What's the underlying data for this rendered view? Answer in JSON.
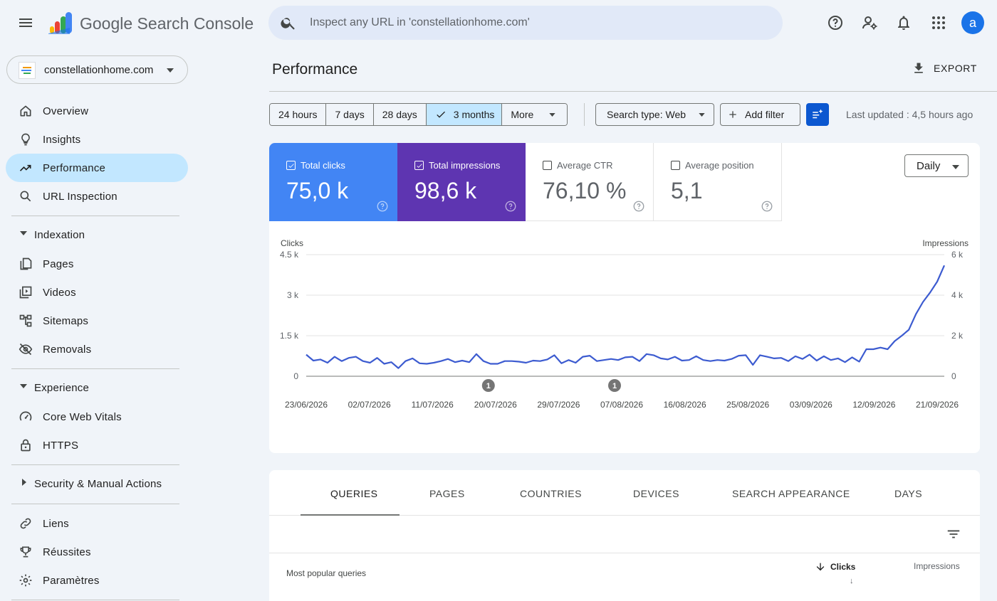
{
  "app": {
    "brand": "Google Search Console",
    "search_placeholder": "Inspect any URL in 'constellationhome.com'",
    "avatar_letter": "a"
  },
  "property": {
    "name": "constellationhome.com"
  },
  "sidebar": {
    "top_items": [
      {
        "label": "Overview",
        "icon": "home-icon"
      },
      {
        "label": "Insights",
        "icon": "lightbulb-icon"
      },
      {
        "label": "Performance",
        "icon": "trending-up-icon",
        "active": true
      },
      {
        "label": "URL Inspection",
        "icon": "search-icon"
      }
    ],
    "indexation": {
      "title": "Indexation",
      "items": [
        {
          "label": "Pages",
          "icon": "pages-icon"
        },
        {
          "label": "Videos",
          "icon": "video-icon"
        },
        {
          "label": "Sitemaps",
          "icon": "sitemap-icon"
        },
        {
          "label": "Removals",
          "icon": "visibility-off-icon"
        }
      ]
    },
    "experience": {
      "title": "Experience",
      "items": [
        {
          "label": "Core Web Vitals",
          "icon": "speed-icon"
        },
        {
          "label": "HTTPS",
          "icon": "lock-icon"
        }
      ]
    },
    "security": {
      "title": "Security & Manual Actions"
    },
    "bottom_items": [
      {
        "label": "Liens",
        "icon": "link-icon"
      },
      {
        "label": "Réussites",
        "icon": "trophy-icon"
      },
      {
        "label": "Paramètres",
        "icon": "gear-icon"
      }
    ]
  },
  "header": {
    "title": "Performance",
    "export_label": "EXPORT"
  },
  "filters": {
    "ranges": [
      "24 hours",
      "7 days",
      "28 days",
      "3 months",
      "More"
    ],
    "selected_range": "3 months",
    "search_type": "Search type: Web",
    "add_filter": "Add filter",
    "last_updated": "Last updated : 4,5 hours ago"
  },
  "metrics": {
    "clicks": {
      "label": "Total clicks",
      "value": "75,0 k",
      "checked": true,
      "color": "#4285f4"
    },
    "impressions": {
      "label": "Total impressions",
      "value": "98,6 k",
      "checked": true,
      "color": "#5e35b1"
    },
    "ctr": {
      "label": "Average CTR",
      "value": "76,10 %",
      "checked": false
    },
    "position": {
      "label": "Average position",
      "value": "5,1",
      "checked": false
    }
  },
  "granularity": "Daily",
  "chart_data": {
    "type": "line",
    "left_axis_label": "Clicks",
    "right_axis_label": "Impressions",
    "left_ticks": [
      "4.5 k",
      "3 k",
      "1.5 k",
      "0"
    ],
    "right_ticks": [
      "6 k",
      "4 k",
      "2 k",
      "0"
    ],
    "ylim_left": [
      0,
      4500
    ],
    "ylim_right": [
      0,
      6000
    ],
    "x_tick_labels": [
      "23/06/2026",
      "02/07/2026",
      "11/07/2026",
      "20/07/2026",
      "29/07/2026",
      "07/08/2026",
      "16/08/2026",
      "25/08/2026",
      "03/09/2026",
      "12/09/2026",
      "21/09/2026"
    ],
    "annotations": [
      {
        "date": "20/07/2026",
        "label": "1"
      },
      {
        "date": "07/08/2026",
        "label": "1"
      }
    ],
    "series": [
      {
        "color": "#3c5bd0",
        "axis": "left",
        "values": [
          800,
          580,
          620,
          500,
          720,
          560,
          680,
          720,
          560,
          500,
          680,
          460,
          520,
          300,
          560,
          660,
          480,
          460,
          500,
          560,
          640,
          520,
          580,
          520,
          820,
          560,
          460,
          460,
          560,
          560,
          540,
          500,
          580,
          560,
          620,
          780,
          480,
          600,
          500,
          720,
          760,
          560,
          600,
          640,
          600,
          700,
          720,
          560,
          820,
          780,
          660,
          620,
          720,
          580,
          600,
          740,
          600,
          560,
          600,
          580,
          640,
          760,
          780,
          420,
          780,
          720,
          660,
          680,
          560,
          740,
          640,
          800,
          580,
          740,
          600,
          660,
          520,
          700,
          540,
          1000,
          1000,
          1060,
          1000,
          1300,
          1500,
          1720,
          2300,
          2750,
          3100,
          3500,
          4100
        ]
      }
    ]
  },
  "table": {
    "tabs": [
      "QUERIES",
      "PAGES",
      "COUNTRIES",
      "DEVICES",
      "SEARCH APPEARANCE",
      "DAYS"
    ],
    "active_tab": "QUERIES",
    "first_col_header": "Most popular queries",
    "clicks_header": "Clicks",
    "sort_indicator": "↓",
    "impressions_header": "Impressions"
  }
}
